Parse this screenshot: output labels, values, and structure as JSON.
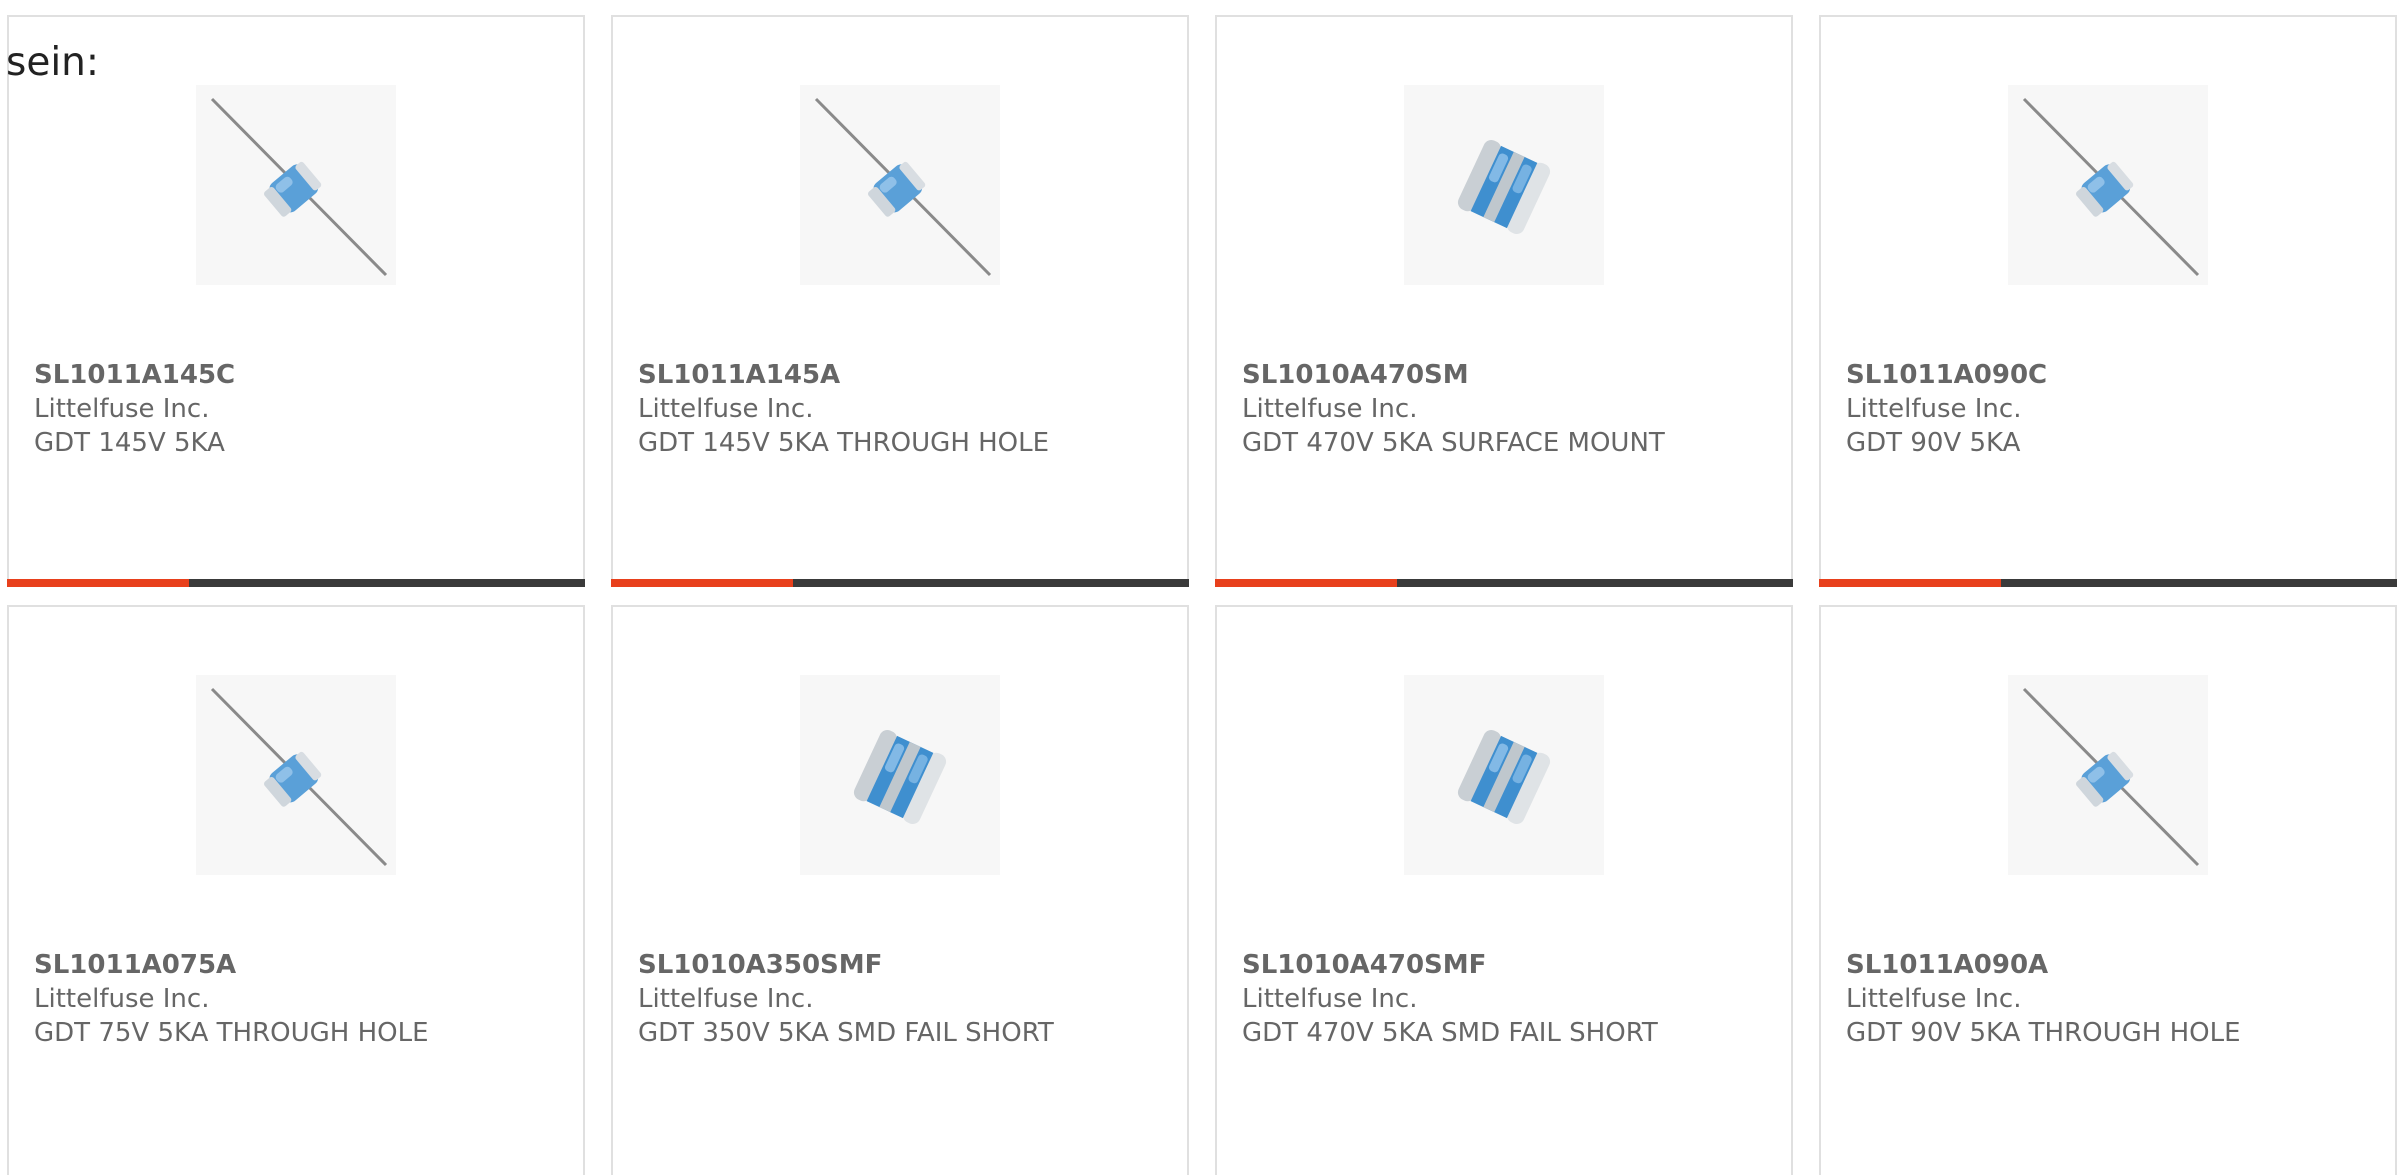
{
  "intro_text": "sein:",
  "colors": {
    "accent": "#e8401c",
    "bar": "#3a3a3a",
    "border": "#e0e0e0",
    "text": "#666666"
  },
  "products": [
    {
      "part_number": "SL1011A145C",
      "manufacturer": "Littelfuse Inc.",
      "description": "GDT 145V 5KA",
      "image_type": "axial-gdt-icon"
    },
    {
      "part_number": "SL1011A145A",
      "manufacturer": "Littelfuse Inc.",
      "description": "GDT 145V 5KA THROUGH HOLE",
      "image_type": "axial-gdt-icon"
    },
    {
      "part_number": "SL1010A470SM",
      "manufacturer": "Littelfuse Inc.",
      "description": "GDT 470V 5KA SURFACE MOUNT",
      "image_type": "smd-gdt-icon"
    },
    {
      "part_number": "SL1011A090C",
      "manufacturer": "Littelfuse Inc.",
      "description": "GDT 90V 5KA",
      "image_type": "axial-gdt-icon"
    },
    {
      "part_number": "SL1011A075A",
      "manufacturer": "Littelfuse Inc.",
      "description": "GDT 75V 5KA THROUGH HOLE",
      "image_type": "axial-gdt-icon"
    },
    {
      "part_number": "SL1010A350SMF",
      "manufacturer": "Littelfuse Inc.",
      "description": "GDT 350V 5KA SMD FAIL SHORT",
      "image_type": "smd-gdt-icon"
    },
    {
      "part_number": "SL1010A470SMF",
      "manufacturer": "Littelfuse Inc.",
      "description": "GDT 470V 5KA SMD FAIL SHORT",
      "image_type": "smd-gdt-icon"
    },
    {
      "part_number": "SL1011A090A",
      "manufacturer": "Littelfuse Inc.",
      "description": "GDT 90V 5KA THROUGH HOLE",
      "image_type": "axial-gdt-icon"
    }
  ]
}
